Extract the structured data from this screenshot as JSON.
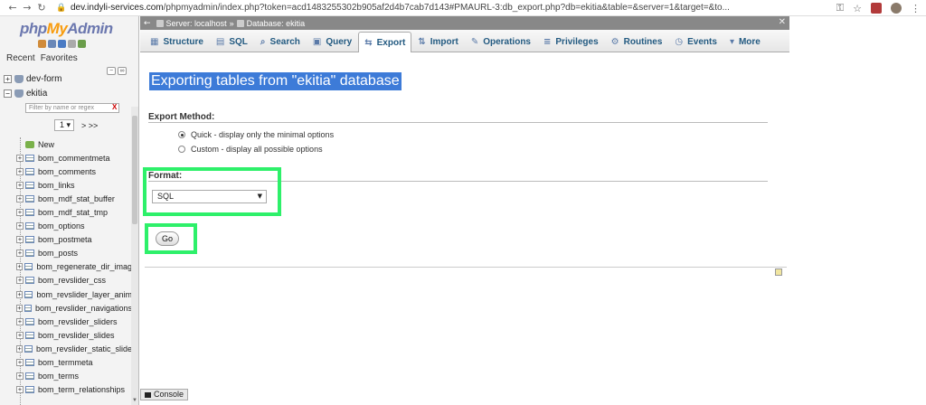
{
  "browser": {
    "url_host": "dev.indyli-services.com",
    "url_rest": "/phpmyadmin/index.php?token=acd1483255302b905af2d4b7cab7d143#PMAURL-3:db_export.php?db=ekitia&table=&server=1&target=&to..."
  },
  "sidebar": {
    "logo_php": "php",
    "logo_my": "My",
    "logo_admin": "Admin",
    "recent_label": "Recent",
    "favorites_label": "Favorites",
    "db_dev_form": "dev-form",
    "db_ekitia": "ekitia",
    "filter_placeholder": "Filter by name or regex",
    "filter_clear": "X",
    "page_select": "1",
    "page_next": "> >>",
    "new_label": "New",
    "tables": [
      "bom_commentmeta",
      "bom_comments",
      "bom_links",
      "bom_mdf_stat_buffer",
      "bom_mdf_stat_tmp",
      "bom_options",
      "bom_postmeta",
      "bom_posts",
      "bom_regenerate_dir_imag",
      "bom_revslider_css",
      "bom_revslider_layer_anim",
      "bom_revslider_navigations",
      "bom_revslider_sliders",
      "bom_revslider_slides",
      "bom_revslider_static_slide",
      "bom_termmeta",
      "bom_terms",
      "bom_term_relationships"
    ]
  },
  "breadcrumb": {
    "server": "Server: localhost",
    "separator": "»",
    "database": "Database: ekitia"
  },
  "tabs": [
    {
      "label": "Structure",
      "icon": "▦"
    },
    {
      "label": "SQL",
      "icon": "▤"
    },
    {
      "label": "Search",
      "icon": "⌕"
    },
    {
      "label": "Query",
      "icon": "▣"
    },
    {
      "label": "Export",
      "icon": "⇆"
    },
    {
      "label": "Import",
      "icon": "⇅"
    },
    {
      "label": "Operations",
      "icon": "✎"
    },
    {
      "label": "Privileges",
      "icon": "≡"
    },
    {
      "label": "Routines",
      "icon": "⚙"
    },
    {
      "label": "Events",
      "icon": "◷"
    },
    {
      "label": "More",
      "icon": "▾"
    }
  ],
  "main": {
    "title": "Exporting tables from \"ekitia\" database",
    "export_method_label": "Export Method:",
    "option_quick": "Quick - display only the minimal options",
    "option_custom": "Custom - display all possible options",
    "format_label": "Format:",
    "format_value": "SQL",
    "go_label": "Go"
  },
  "console": {
    "label": "Console"
  },
  "colors": {
    "highlight": "#2ef06a",
    "title_bg": "#3d7bd8",
    "tab_text": "#235a81"
  }
}
